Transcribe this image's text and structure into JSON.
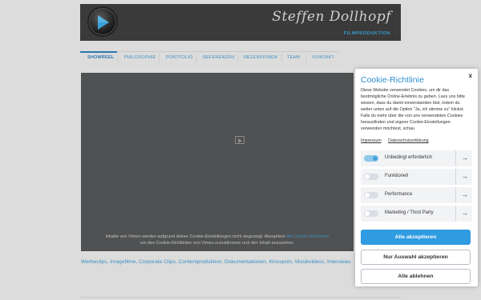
{
  "brand": {
    "name": "Steffen Dollhopf",
    "subtitle": "FILMPRODUKTION",
    "accent": "#3aa0d8"
  },
  "nav": {
    "items": [
      {
        "label": "SHOWREEL",
        "active": true
      },
      {
        "label": "PHILOSOPHIE",
        "active": false
      },
      {
        "label": "PORTFOLIO",
        "active": false
      },
      {
        "label": "REFERENZEN",
        "active": false
      },
      {
        "label": "REZENSIONEN",
        "active": false
      },
      {
        "label": "TEAM",
        "active": false
      },
      {
        "label": "KONTAKT",
        "active": false
      }
    ]
  },
  "video": {
    "message_before": "Inhalte von Vimeo werden aufgrund deiner Cookie-Einstellungen nicht angezeigt. Akzeptiere",
    "message_link": "die Cookie-Richtlinien",
    "message_after": "um den Cookie-Richtlinien von Vimeo zuzustimmen und den Inhalt anzusehen."
  },
  "tags_line": "Werbeclips, Imagefilme, Corporate Clips, Contentproduktion, Dokumentationen, Kinospots, Musikvideos, Interviews",
  "cookie": {
    "close": "x",
    "title": "Cookie-Richtlinie",
    "text": "Diese Website verwendet Cookies, um dir das bestmögliche Online-Erlebnis zu geben. Lass uns bitte wissen, dass du damit einverstanden bist, indem du weiter unten auf die Option \"Ja, ich stimme zu\" klickst. Falls du mehr über die von uns verwendeten Cookies herausfinden und eigene Cookie-Einstellungen verwenden möchtest, schau",
    "links": [
      "Impressum",
      "Datenschutzerklärung"
    ],
    "categories": [
      {
        "label": "Unbedingt erforderlich",
        "enabled": true
      },
      {
        "label": "Funktionell",
        "enabled": false
      },
      {
        "label": "Performance",
        "enabled": false
      },
      {
        "label": "Marketing / Third Party",
        "enabled": false
      }
    ],
    "arrow": "→",
    "buttons": {
      "accept_all": "Alle akzeptieren",
      "accept_selection": "Nur Auswahl akzeptieren",
      "reject_all": "Alle ablehnen"
    },
    "accent": "#2f9be0"
  }
}
